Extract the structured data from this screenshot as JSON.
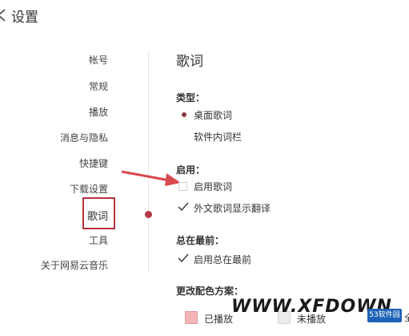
{
  "header": {
    "title": "设置",
    "back_icon": "chevron-left-icon"
  },
  "sidebar": {
    "items": [
      {
        "label": "帐号"
      },
      {
        "label": "常规"
      },
      {
        "label": "播放"
      },
      {
        "label": "消息与隐私"
      },
      {
        "label": "快捷键"
      },
      {
        "label": "下载设置"
      },
      {
        "label": "歌词",
        "active": true
      },
      {
        "label": "工具"
      },
      {
        "label": "关于网易云音乐"
      }
    ]
  },
  "main": {
    "section_title": "歌词",
    "type_group": {
      "label": "类型：",
      "options": [
        {
          "label": "桌面歌词",
          "selected": true
        },
        {
          "label": "软件内词栏",
          "selected": false
        }
      ]
    },
    "enable_group": {
      "label": "启用：",
      "options": [
        {
          "label": "启用歌词",
          "checked": false
        },
        {
          "label": "外文歌词显示翻译",
          "checked": true
        }
      ]
    },
    "ontop_group": {
      "label": "总在最前：",
      "options": [
        {
          "label": "启用总在最前",
          "checked": true
        }
      ]
    },
    "color_group": {
      "label": "更改配色方案：",
      "schemes": [
        {
          "label": "已播放",
          "color": "#f3b3b7"
        },
        {
          "label": "未播放",
          "color": "#ececec"
        }
      ]
    }
  },
  "watermark": {
    "text": "WWW.XFDOWN",
    "badge": "53软件园",
    "tail": "全"
  },
  "colors": {
    "accent": "#b33a45",
    "highlight_box": "#b5323d",
    "arrow": "#d94a4e"
  }
}
